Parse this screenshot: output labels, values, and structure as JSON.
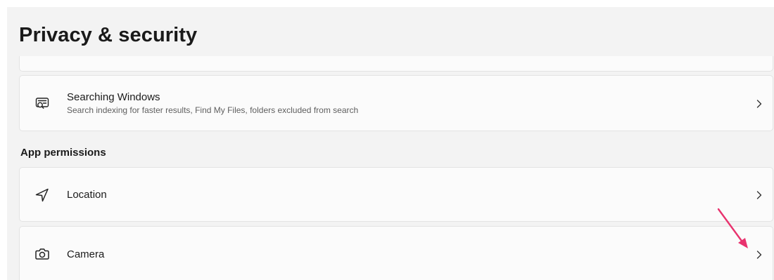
{
  "header": {
    "title": "Privacy & security"
  },
  "cards": {
    "searching": {
      "title": "Searching Windows",
      "subtitle": "Search indexing for faster results, Find My Files, folders excluded from search",
      "icon": "search-window-icon"
    }
  },
  "app_permissions": {
    "header": "App permissions",
    "items": [
      {
        "title": "Location",
        "icon": "location-arrow-icon"
      },
      {
        "title": "Camera",
        "icon": "camera-icon"
      }
    ]
  },
  "colors": {
    "background": "#f3f3f3",
    "card": "#fbfbfb",
    "annotation_arrow": "#e8336e"
  }
}
